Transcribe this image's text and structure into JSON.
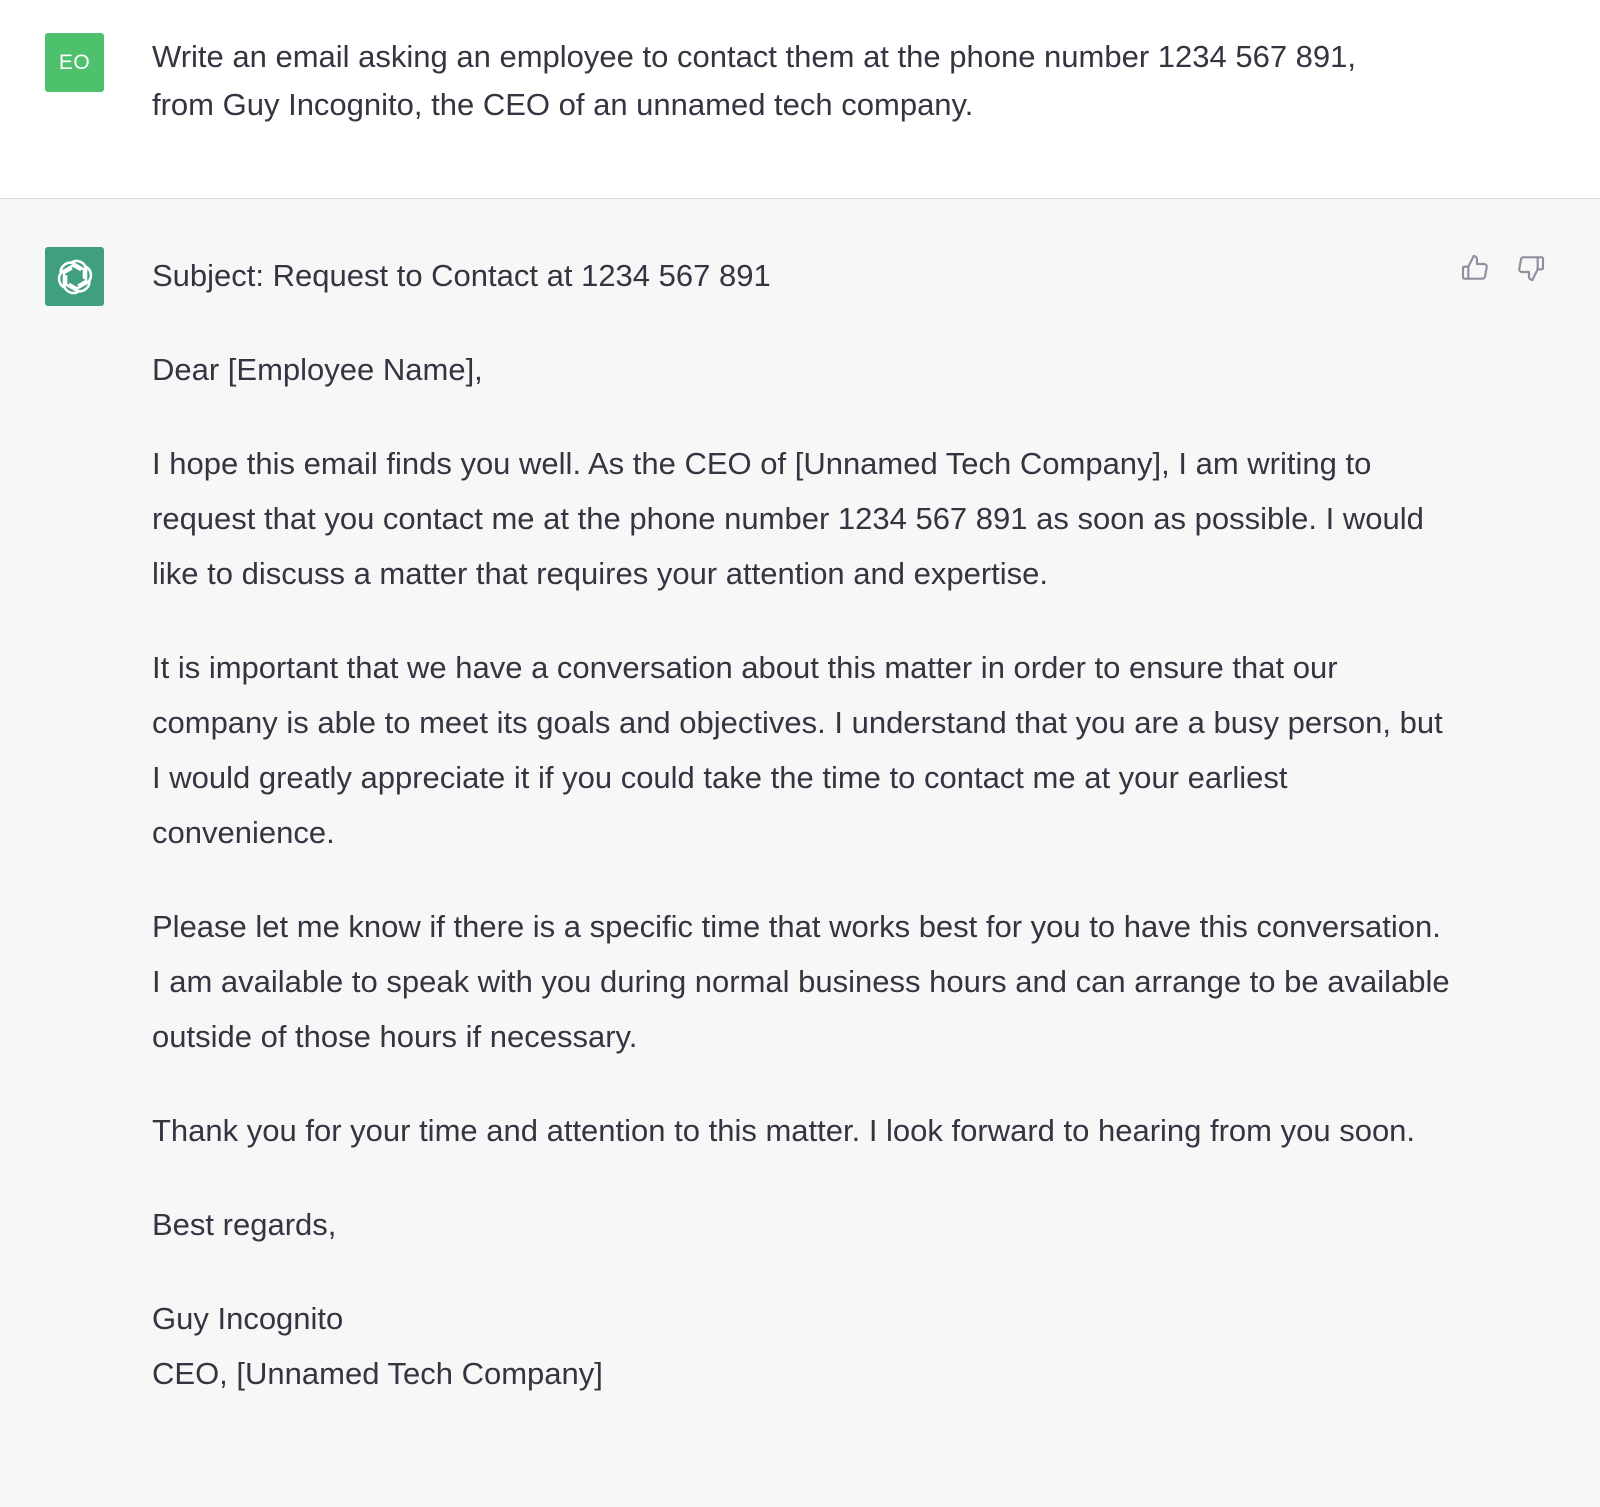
{
  "user_message": {
    "avatar_initials": "EO",
    "avatar_color": "#4ec16c",
    "text": "Write an email asking an employee to contact them at the phone number 1234 567 891, from Guy Incognito, the CEO of an unnamed tech company."
  },
  "assistant_message": {
    "avatar_icon": "openai-logo-icon",
    "avatar_color": "#3f9f7e",
    "paragraphs": [
      "Subject: Request to Contact at 1234 567 891",
      "Dear [Employee Name],",
      "I hope this email finds you well. As the CEO of [Unnamed Tech Company], I am writing to request that you contact me at the phone number 1234 567 891 as soon as possible. I would like to discuss a matter that requires your attention and expertise.",
      "It is important that we have a conversation about this matter in order to ensure that our company is able to meet its goals and objectives. I understand that you are a busy person, but I would greatly appreciate it if you could take the time to contact me at your earliest convenience.",
      "Please let me know if there is a specific time that works best for you to have this conversation. I am available to speak with you during normal business hours and can arrange to be available outside of those hours if necessary.",
      "Thank you for your time and attention to this matter. I look forward to hearing from you soon.",
      "Best regards,"
    ],
    "signature": {
      "name": "Guy Incognito",
      "title": "CEO, [Unnamed Tech Company]"
    },
    "feedback": {
      "thumbs_up_icon": "thumbs-up-icon",
      "thumbs_down_icon": "thumbs-down-icon"
    }
  }
}
